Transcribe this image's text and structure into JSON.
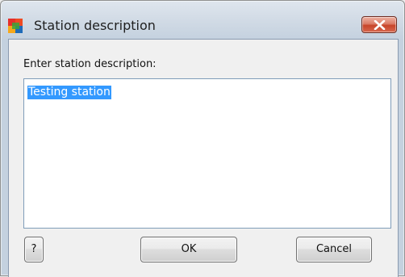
{
  "window": {
    "title": "Station description",
    "icon": "avg-logo-icon",
    "close_icon": "close-icon"
  },
  "dialog": {
    "prompt": "Enter station description:",
    "description_value": "Testing station"
  },
  "buttons": {
    "help_label": "?",
    "ok_label": "OK",
    "cancel_label": "Cancel"
  },
  "colors": {
    "selection": "#3399ff",
    "close_button": "#c7452a"
  }
}
